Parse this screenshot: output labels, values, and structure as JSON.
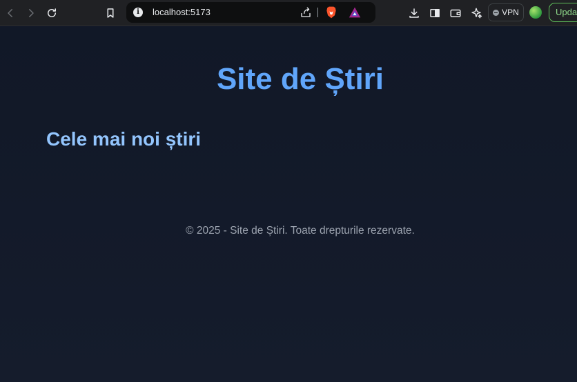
{
  "browser": {
    "url": "localhost:5173",
    "vpn_label": "VPN",
    "update_label": "Update",
    "icons": [
      "back-icon",
      "forward-icon",
      "reload-icon",
      "bookmark-icon",
      "site-info-icon",
      "share-icon",
      "brave-shields-icon",
      "brave-rewards-icon",
      "download-icon",
      "sidebar-icon",
      "wallet-icon",
      "leo-ai-icon",
      "vpn-icon",
      "profile-avatar"
    ],
    "colors": {
      "toolbar": "#202124",
      "omnibox": "#0e0f10",
      "update_accent": "#5fbf5b"
    }
  },
  "page": {
    "site_title": "Site de Știri",
    "section_heading": "Cele mai noi știri",
    "footer": "© 2025 - Site de Știri. Toate drepturile rezervate.",
    "colors": {
      "background": "#111827",
      "title": "#60a5fa",
      "heading": "#93c5fd",
      "footer_text": "#9ca3af"
    }
  }
}
